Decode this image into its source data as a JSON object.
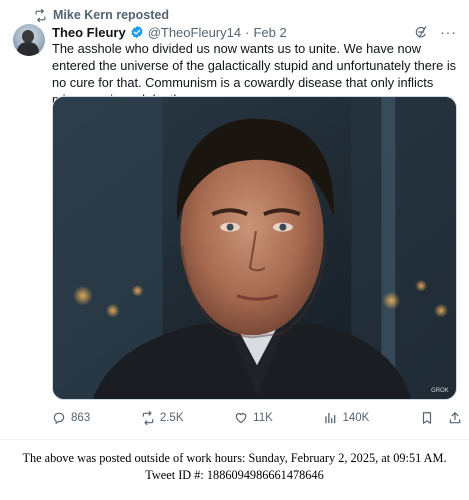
{
  "repost": {
    "text": "Mike Kern reposted",
    "icon": "repost-icon"
  },
  "tweet": {
    "author_name": "Theo Fleury",
    "handle": "@TheoFleury14",
    "separator": "·",
    "date": "Feb 2",
    "verified_color": "#1d9bf0",
    "body": "The asshole who divided us now wants us to unite. We have now entered the universe of the galactically stupid and unfortunately there is no cure for that. Communism is a cowardly disease that only inflicts misery, pain and death.",
    "media": {
      "description_icon": "portrait-photo",
      "watermark": "GROK"
    },
    "stats": {
      "replies": "863",
      "reposts": "2.5K",
      "likes": "11K",
      "views": "140K"
    }
  },
  "caption": {
    "line1": "The above was posted outside of work hours: Sunday, February 2, 2025, at 09:51 AM.",
    "line2": "Tweet ID #: 1886094986661478646"
  },
  "colors": {
    "secondary_text": "#536471",
    "text": "#0f1419",
    "accent": "#1d9bf0"
  }
}
